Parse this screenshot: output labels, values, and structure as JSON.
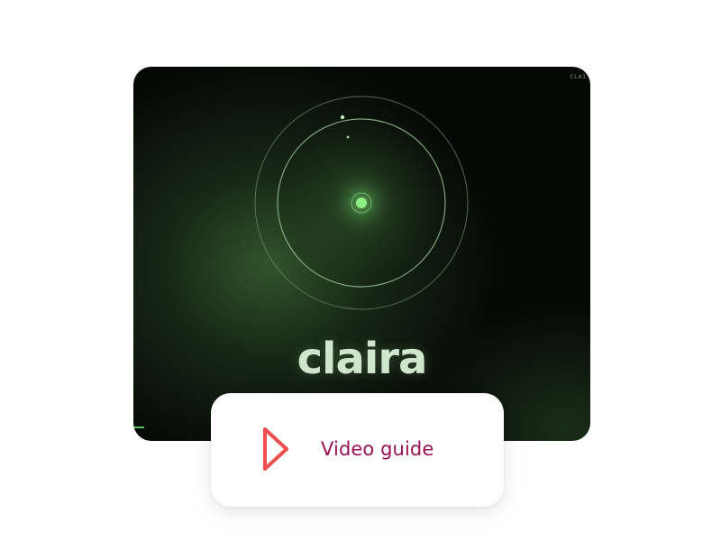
{
  "video": {
    "brand": "claira",
    "corner_tag": "CLAI",
    "accent_color": "#7fe07a"
  },
  "guide": {
    "label": "Video guide",
    "icon": "play-icon",
    "label_color": "#9a1155",
    "icon_color": "#ef4e4e"
  }
}
